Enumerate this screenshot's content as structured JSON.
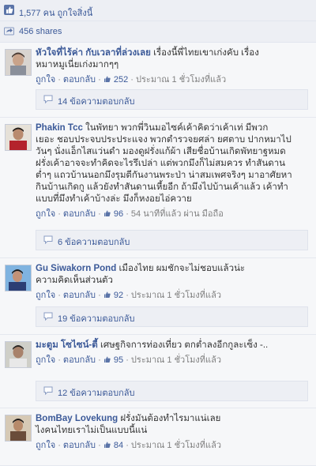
{
  "summary": {
    "likes_text": "1,577 คน ถูกใจสิ่งนี้",
    "shares_text": "456 shares"
  },
  "comments": [
    {
      "name": "หัวใจที่ไร้ค่า กับเวลาที่ล่วงเลย",
      "lines": [
        "เรื่องนี้พี่ไทยเขาเก่งคับ เรื่อง",
        "หมาหมูเนี่ยเก่งมากๆๆ"
      ],
      "like_label": "ถูกใจ",
      "reply_label": "ตอบกลับ",
      "like_count": "252",
      "time": "ประมาณ 1 ชั่วโมงที่แล้ว",
      "replies": "14 ข้อความตอบกลับ"
    },
    {
      "name": "Phakin Tcc",
      "lines": [
        "ในพัทยา พวกพี่วินมอไซค์เค้าคิดว่าเค้าเท่ มีพวก",
        "เยอะ ชอบประจบประประแจง พวกตำรวจยศล่า ยศตาบ ปากหมาไป",
        "วันๆ นั่งแอ็กไสแว่นดำ มองดูฝรั่งแก้ผ้า เสียชื่อบ้านเกิดพัทยาฐหมด",
        "ฝรั่งเค้าอาจจะทำคิดจะไรรึเปล่า แต่พวกมึงก็ไม่สมควร ทำสันดาน",
        "ต่ำๆ แถวบ้านนอกมึงรุมตีกันงานพระป่า น่าสมเพศจริงๆ มาอาศัยหา",
        "กินบ้านเกิดกู แล้วยังทำสันดานเหี้ยอีก ถ้ามึงไปบ้านเค้าแล้ว เค้าทำ",
        "แบบที่มึงทำเค้าบ้างล่ะ มึงก็หงอยไอ่ควาย"
      ],
      "like_label": "ถูกใจ",
      "reply_label": "ตอบกลับ",
      "like_count": "96",
      "time": "54 นาทีที่แล้ว ผ่าน มือถือ",
      "replies": "6 ข้อความตอบกลับ"
    },
    {
      "name": "Gu Siwakorn Pond",
      "lines": [
        "เมืองไทย ผมชักจะไม่ชอบแล้วน่ะ",
        "ความคิดเห็นส่วนตัว"
      ],
      "like_label": "ถูกใจ",
      "reply_label": "ตอบกลับ",
      "like_count": "92",
      "time": "ประมาณ 1 ชั่วโมงที่แล้ว",
      "replies": "19 ข้อความตอบกลับ"
    },
    {
      "name": "มะตูม โซไซน์-ตี้",
      "lines": [
        "เศษฐกิจการท่องเที่ยว ตกต่ำลงอีกกูละเซ็ง -.."
      ],
      "like_label": "ถูกใจ",
      "reply_label": "ตอบกลับ",
      "like_count": "95",
      "time": "ประมาณ 1 ชั่วโมงที่แล้ว",
      "replies": "12 ข้อความตอบกลับ"
    },
    {
      "name": "BomBay Lovekung",
      "lines": [
        "ฝรั่งมันต้องทำไรมาแน่เลย",
        "ไงคนไทยเราไม่เป็นแบบนี้แน่"
      ],
      "like_label": "ถูกใจ",
      "reply_label": "ตอบกลับ",
      "like_count": "84",
      "time": "ประมาณ 1 ชั่วโมงที่แล้ว"
    }
  ],
  "colors": {
    "link": "#3b5998",
    "panel": "#f6f7f9",
    "reply_box": "#edeff4",
    "meta": "#7f7f7f"
  },
  "icons": [
    "like-thumb-icon",
    "share-icon",
    "small-thumb-icon",
    "reply-bubble-icon",
    "avatar"
  ]
}
